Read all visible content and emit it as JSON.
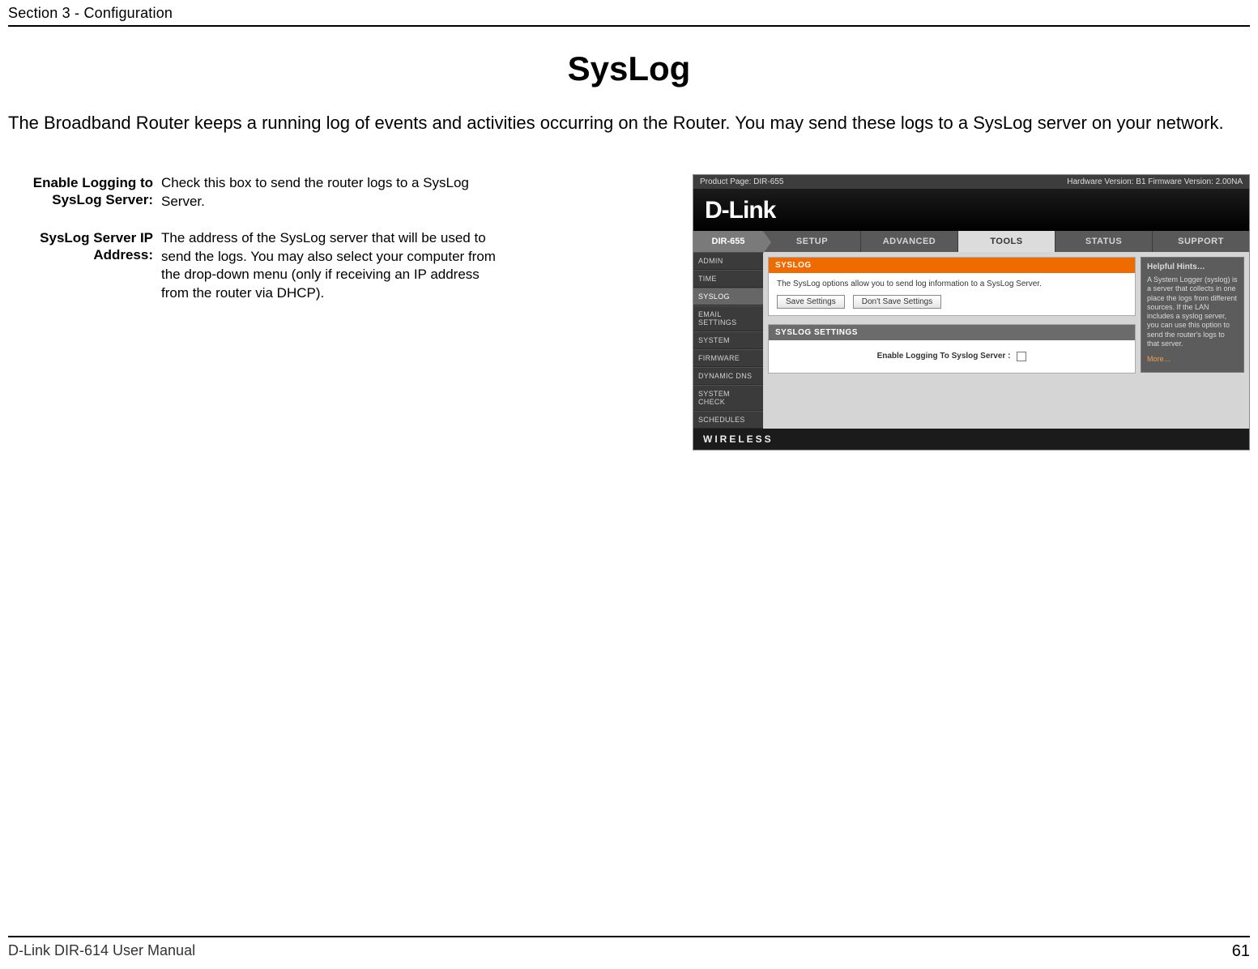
{
  "header": {
    "section": "Section 3 - Configuration"
  },
  "title": "SysLog",
  "intro": "The Broadband Router keeps a running log of events and activities occurring on the Router. You may send these logs to a SysLog server on your network.",
  "defs": [
    {
      "label": "Enable Logging to SysLog Server:",
      "text": "Check this box to send the router logs to a SysLog Server."
    },
    {
      "label": "SysLog Server IP Address:",
      "text": "The address of the SysLog server that will be used to send the logs. You may also select your computer from the drop-down menu (only if receiving an IP address from the router via DHCP)."
    }
  ],
  "shot": {
    "top_left": "Product Page: DIR-655",
    "top_right": "Hardware Version: B1    Firmware Version: 2.00NA",
    "brand": "D-Link",
    "model": "DIR-655",
    "tabs": [
      "SETUP",
      "ADVANCED",
      "TOOLS",
      "STATUS",
      "SUPPORT"
    ],
    "active_tab": 2,
    "side": [
      "ADMIN",
      "TIME",
      "SYSLOG",
      "EMAIL SETTINGS",
      "SYSTEM",
      "FIRMWARE",
      "DYNAMIC DNS",
      "SYSTEM CHECK",
      "SCHEDULES"
    ],
    "active_side": 2,
    "panel1_title": "SYSLOG",
    "panel1_text": "The SysLog options allow you to send log information to a SysLog Server.",
    "btn_save": "Save Settings",
    "btn_dont": "Don't Save Settings",
    "panel2_title": "SYSLOG SETTINGS",
    "setting_label": "Enable Logging To Syslog Server :",
    "hints_title": "Helpful Hints…",
    "hints_text": "A System Logger (syslog) is a server that collects in one place the logs from different sources. If the LAN includes a syslog server, you can use this option to send the router's logs to that server.",
    "hints_more": "More…",
    "wireless": "WIRELESS"
  },
  "footer": {
    "left": "D-Link DIR-614 User Manual",
    "page": "61"
  }
}
